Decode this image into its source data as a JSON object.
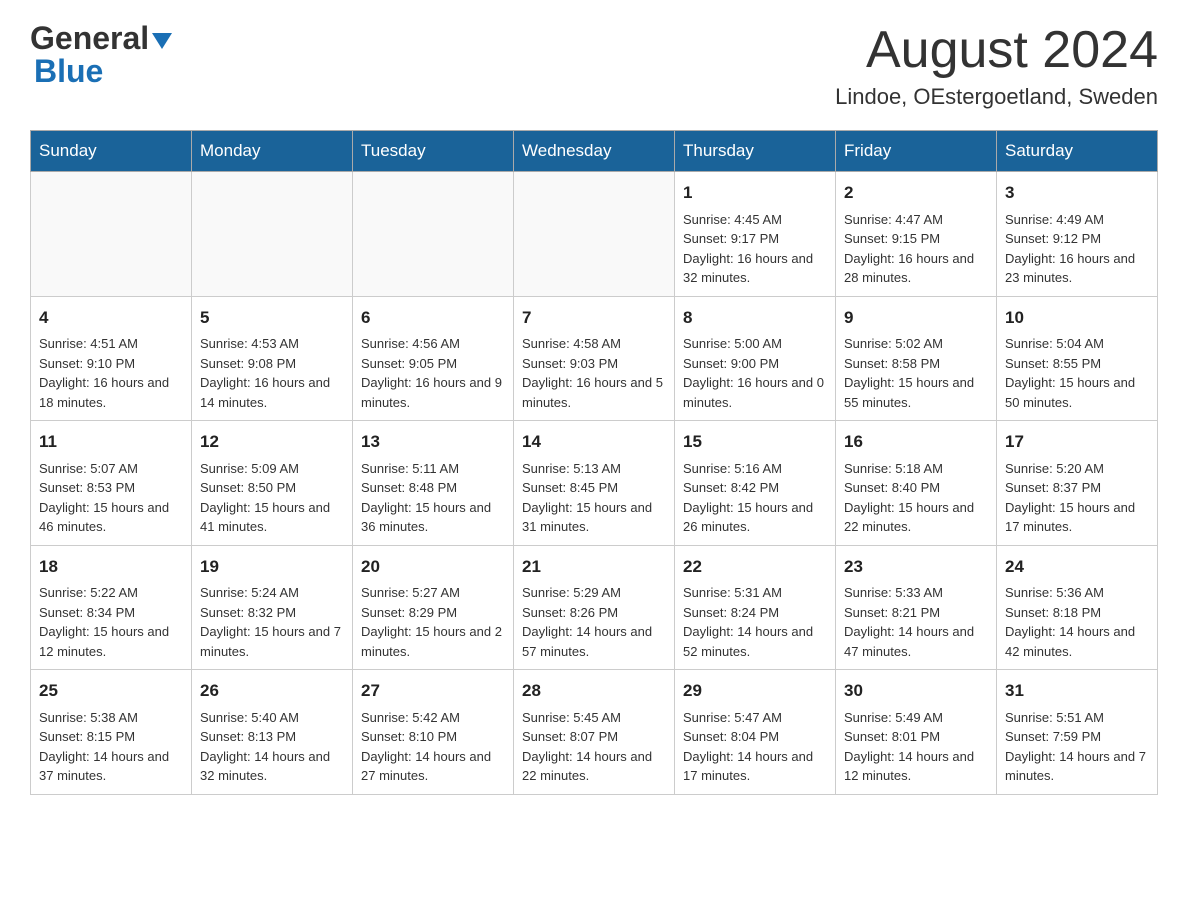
{
  "header": {
    "logo_general": "General",
    "logo_blue": "Blue",
    "month_title": "August 2024",
    "location": "Lindoe, OEstergoetland, Sweden"
  },
  "days_of_week": [
    "Sunday",
    "Monday",
    "Tuesday",
    "Wednesday",
    "Thursday",
    "Friday",
    "Saturday"
  ],
  "weeks": [
    [
      {
        "day": "",
        "info": ""
      },
      {
        "day": "",
        "info": ""
      },
      {
        "day": "",
        "info": ""
      },
      {
        "day": "",
        "info": ""
      },
      {
        "day": "1",
        "info": "Sunrise: 4:45 AM\nSunset: 9:17 PM\nDaylight: 16 hours and 32 minutes."
      },
      {
        "day": "2",
        "info": "Sunrise: 4:47 AM\nSunset: 9:15 PM\nDaylight: 16 hours and 28 minutes."
      },
      {
        "day": "3",
        "info": "Sunrise: 4:49 AM\nSunset: 9:12 PM\nDaylight: 16 hours and 23 minutes."
      }
    ],
    [
      {
        "day": "4",
        "info": "Sunrise: 4:51 AM\nSunset: 9:10 PM\nDaylight: 16 hours and 18 minutes."
      },
      {
        "day": "5",
        "info": "Sunrise: 4:53 AM\nSunset: 9:08 PM\nDaylight: 16 hours and 14 minutes."
      },
      {
        "day": "6",
        "info": "Sunrise: 4:56 AM\nSunset: 9:05 PM\nDaylight: 16 hours and 9 minutes."
      },
      {
        "day": "7",
        "info": "Sunrise: 4:58 AM\nSunset: 9:03 PM\nDaylight: 16 hours and 5 minutes."
      },
      {
        "day": "8",
        "info": "Sunrise: 5:00 AM\nSunset: 9:00 PM\nDaylight: 16 hours and 0 minutes."
      },
      {
        "day": "9",
        "info": "Sunrise: 5:02 AM\nSunset: 8:58 PM\nDaylight: 15 hours and 55 minutes."
      },
      {
        "day": "10",
        "info": "Sunrise: 5:04 AM\nSunset: 8:55 PM\nDaylight: 15 hours and 50 minutes."
      }
    ],
    [
      {
        "day": "11",
        "info": "Sunrise: 5:07 AM\nSunset: 8:53 PM\nDaylight: 15 hours and 46 minutes."
      },
      {
        "day": "12",
        "info": "Sunrise: 5:09 AM\nSunset: 8:50 PM\nDaylight: 15 hours and 41 minutes."
      },
      {
        "day": "13",
        "info": "Sunrise: 5:11 AM\nSunset: 8:48 PM\nDaylight: 15 hours and 36 minutes."
      },
      {
        "day": "14",
        "info": "Sunrise: 5:13 AM\nSunset: 8:45 PM\nDaylight: 15 hours and 31 minutes."
      },
      {
        "day": "15",
        "info": "Sunrise: 5:16 AM\nSunset: 8:42 PM\nDaylight: 15 hours and 26 minutes."
      },
      {
        "day": "16",
        "info": "Sunrise: 5:18 AM\nSunset: 8:40 PM\nDaylight: 15 hours and 22 minutes."
      },
      {
        "day": "17",
        "info": "Sunrise: 5:20 AM\nSunset: 8:37 PM\nDaylight: 15 hours and 17 minutes."
      }
    ],
    [
      {
        "day": "18",
        "info": "Sunrise: 5:22 AM\nSunset: 8:34 PM\nDaylight: 15 hours and 12 minutes."
      },
      {
        "day": "19",
        "info": "Sunrise: 5:24 AM\nSunset: 8:32 PM\nDaylight: 15 hours and 7 minutes."
      },
      {
        "day": "20",
        "info": "Sunrise: 5:27 AM\nSunset: 8:29 PM\nDaylight: 15 hours and 2 minutes."
      },
      {
        "day": "21",
        "info": "Sunrise: 5:29 AM\nSunset: 8:26 PM\nDaylight: 14 hours and 57 minutes."
      },
      {
        "day": "22",
        "info": "Sunrise: 5:31 AM\nSunset: 8:24 PM\nDaylight: 14 hours and 52 minutes."
      },
      {
        "day": "23",
        "info": "Sunrise: 5:33 AM\nSunset: 8:21 PM\nDaylight: 14 hours and 47 minutes."
      },
      {
        "day": "24",
        "info": "Sunrise: 5:36 AM\nSunset: 8:18 PM\nDaylight: 14 hours and 42 minutes."
      }
    ],
    [
      {
        "day": "25",
        "info": "Sunrise: 5:38 AM\nSunset: 8:15 PM\nDaylight: 14 hours and 37 minutes."
      },
      {
        "day": "26",
        "info": "Sunrise: 5:40 AM\nSunset: 8:13 PM\nDaylight: 14 hours and 32 minutes."
      },
      {
        "day": "27",
        "info": "Sunrise: 5:42 AM\nSunset: 8:10 PM\nDaylight: 14 hours and 27 minutes."
      },
      {
        "day": "28",
        "info": "Sunrise: 5:45 AM\nSunset: 8:07 PM\nDaylight: 14 hours and 22 minutes."
      },
      {
        "day": "29",
        "info": "Sunrise: 5:47 AM\nSunset: 8:04 PM\nDaylight: 14 hours and 17 minutes."
      },
      {
        "day": "30",
        "info": "Sunrise: 5:49 AM\nSunset: 8:01 PM\nDaylight: 14 hours and 12 minutes."
      },
      {
        "day": "31",
        "info": "Sunrise: 5:51 AM\nSunset: 7:59 PM\nDaylight: 14 hours and 7 minutes."
      }
    ]
  ]
}
